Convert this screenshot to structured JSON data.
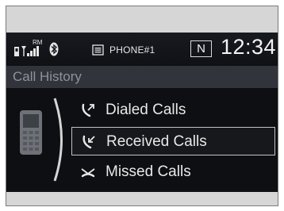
{
  "status_bar": {
    "roaming_label": "RM",
    "device_name": "PHONE#1",
    "gear": "N",
    "clock": "12:34"
  },
  "title": "Call History",
  "menu": {
    "items": [
      {
        "label": "Dialed Calls",
        "icon": "dialed-call-icon",
        "selected": false
      },
      {
        "label": "Received Calls",
        "icon": "received-call-icon",
        "selected": true
      },
      {
        "label": "Missed Calls",
        "icon": "missed-call-icon",
        "selected": false
      }
    ]
  },
  "colors": {
    "screen_background": "#0d0f12",
    "title_bar": "#31343a",
    "text": "#e8e8e8",
    "selection_border": "#bfc3c8"
  }
}
